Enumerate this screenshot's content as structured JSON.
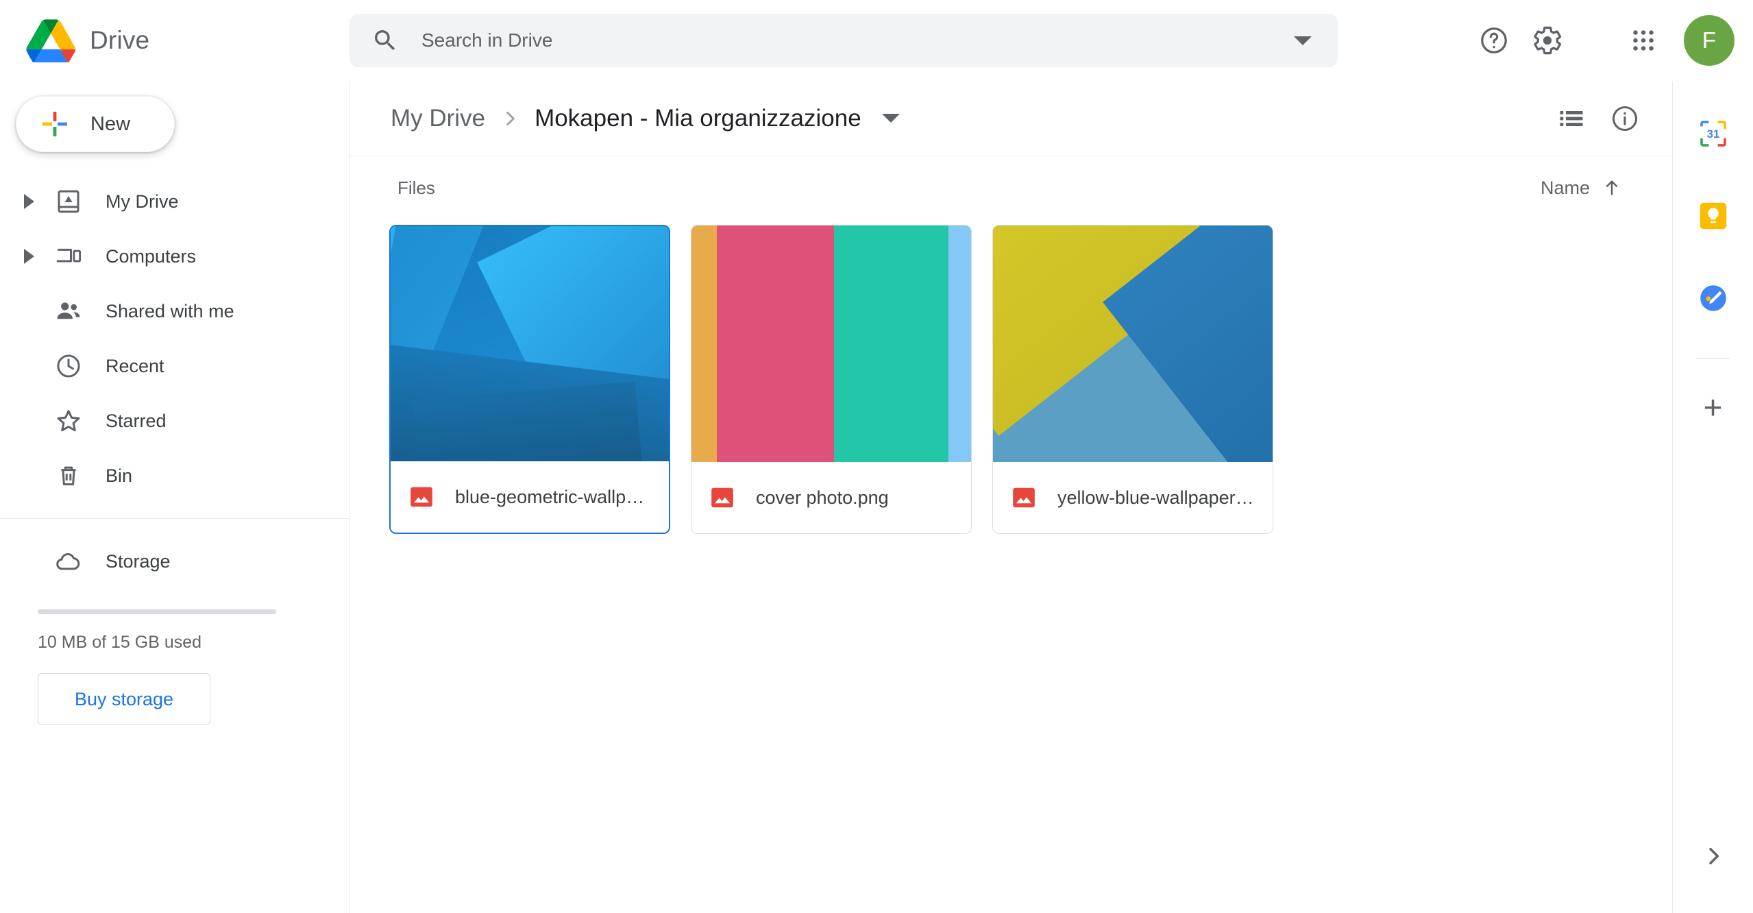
{
  "app": {
    "brand_name": "Drive",
    "logo_icon": "drive-logo"
  },
  "search": {
    "placeholder": "Search in Drive",
    "value": "",
    "icon": "search-icon",
    "options_icon": "chevron-down-icon"
  },
  "topbar": {
    "help_icon": "help-circle-icon",
    "settings_icon": "gear-icon",
    "apps_icon": "apps-grid-icon",
    "avatar_letter": "F",
    "avatar_color": "#6aa543"
  },
  "sidebar": {
    "new_button": {
      "label": "New",
      "icon": "plus-multicolor-icon"
    },
    "items": [
      {
        "label": "My Drive",
        "icon": "my-drive-icon",
        "expandable": true
      },
      {
        "label": "Computers",
        "icon": "computers-icon",
        "expandable": true
      },
      {
        "label": "Shared with me",
        "icon": "shared-people-icon",
        "expandable": false
      },
      {
        "label": "Recent",
        "icon": "clock-icon",
        "expandable": false
      },
      {
        "label": "Starred",
        "icon": "star-icon",
        "expandable": false
      },
      {
        "label": "Bin",
        "icon": "trash-icon",
        "expandable": false
      }
    ],
    "storage": {
      "label": "Storage",
      "icon": "cloud-icon",
      "usage_text": "10 MB of 15 GB used",
      "used_percent": 0.07,
      "buy_label": "Buy storage",
      "buy_color": "#1a73e8"
    }
  },
  "breadcrumb": {
    "root": "My Drive",
    "separator_icon": "chevron-right-icon",
    "current": "Mokapen - Mia organizzazione",
    "dropdown_icon": "caret-down-icon"
  },
  "toolbar": {
    "list_view_icon": "list-view-icon",
    "info_icon": "info-circle-icon"
  },
  "files_section": {
    "title": "Files",
    "sort": {
      "label": "Name",
      "direction_icon": "arrow-up-icon"
    },
    "files": [
      {
        "name": "blue-geometric-wallp…",
        "type_icon": "image-file-icon",
        "selected": true,
        "thumb": "blue-geometric"
      },
      {
        "name": "cover photo.png",
        "type_icon": "image-file-icon",
        "selected": false,
        "thumb": "color-bands",
        "bands": [
          {
            "color": "#e8ab4b",
            "width": 9
          },
          {
            "color": "#de5279",
            "width": 42
          },
          {
            "color": "#23c7a7",
            "width": 41
          },
          {
            "color": "#84c8f5",
            "width": 8
          }
        ]
      },
      {
        "name": "yellow-blue-wallpaper…",
        "type_icon": "image-file-icon",
        "selected": false,
        "thumb": "yellow-blue-diagonal"
      }
    ]
  },
  "right_rail": {
    "apps": [
      {
        "name": "google-calendar",
        "icon": "calendar-31-icon"
      },
      {
        "name": "google-keep",
        "icon": "keep-bulb-icon"
      },
      {
        "name": "google-tasks",
        "icon": "tasks-pencil-icon"
      }
    ],
    "add_label": "+",
    "expand_icon": "chevron-right-icon"
  }
}
